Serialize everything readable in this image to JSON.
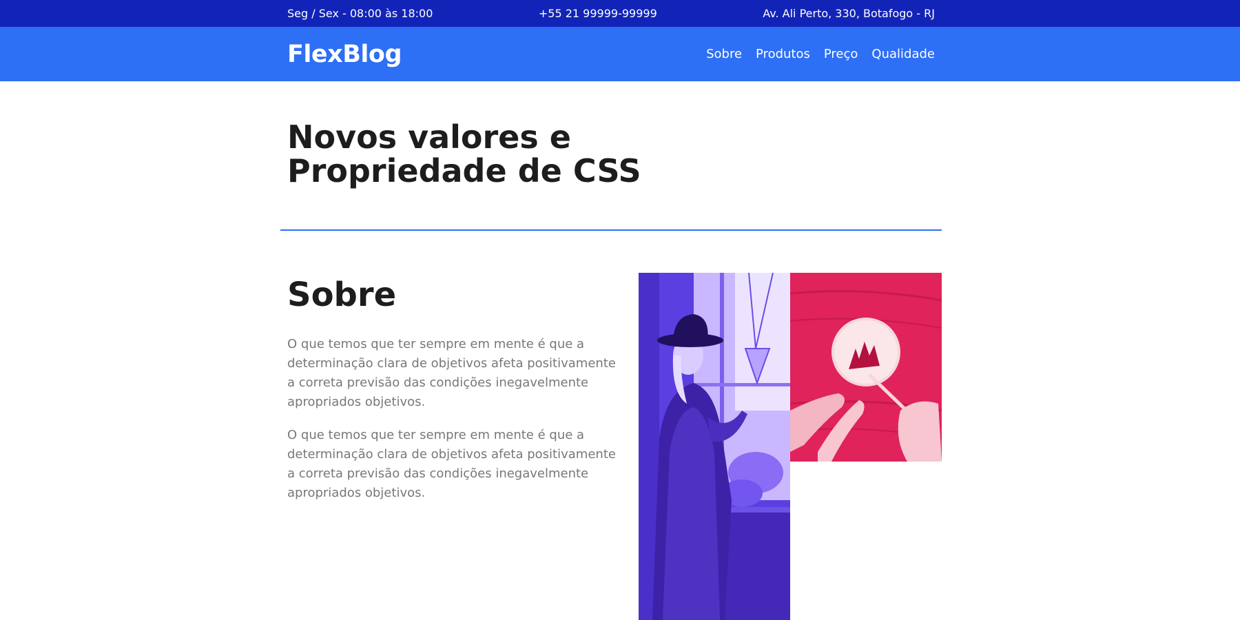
{
  "topbar": {
    "hours": "Seg / Sex - 08:00 às 18:00",
    "phone": "+55 21 99999-99999",
    "address": "Av. Ali Perto, 330, Botafogo - RJ"
  },
  "header": {
    "logo": "FlexBlog",
    "menu": [
      "Sobre",
      "Produtos",
      "Preço",
      "Qualidade"
    ]
  },
  "hero": {
    "title_line1": "Novos valores e",
    "title_line2": "Propriedade de CSS"
  },
  "about": {
    "title": "Sobre",
    "paragraphs": [
      "O que temos que ter sempre em mente é que a determinação clara de objetivos afeta positivamente a correta previsão das condições inegavelmente apropriados objetivos.",
      "O que temos que ter sempre em mente é que a determinação clara de objetivos afeta positivamente a correta previsão das condições inegavelmente apropriados objetivos."
    ]
  },
  "colors": {
    "topbar": "#1224b8",
    "navbar": "#2d6ff5",
    "heading": "#1d1d1f",
    "body_text": "#77777c",
    "image_purple": "#6a4df0",
    "image_pink": "#e8285c"
  }
}
